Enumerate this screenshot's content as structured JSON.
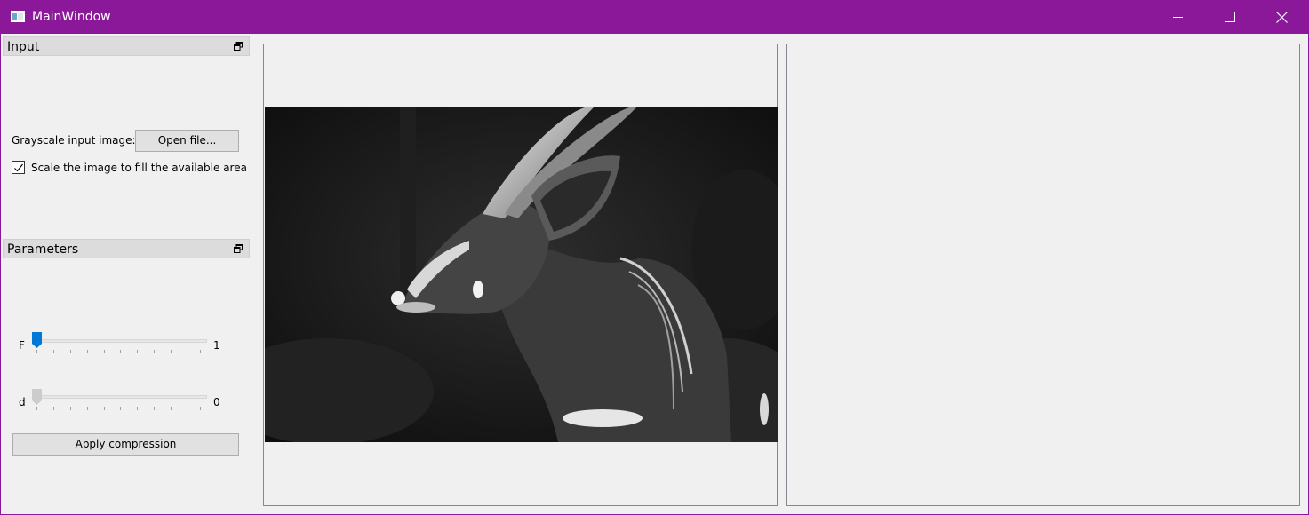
{
  "window": {
    "title": "MainWindow",
    "titlebar_color": "#8a1899",
    "icons": {
      "minimize": "minimize-icon",
      "maximize": "maximize-icon",
      "close": "close-icon"
    }
  },
  "input_dock": {
    "title": "Input",
    "image_label": "Grayscale input image:",
    "open_button": "Open file...",
    "scale_checkbox": {
      "label": "Scale the image to fill the available area",
      "checked": true
    }
  },
  "parameters_dock": {
    "title": "Parameters",
    "sliders": [
      {
        "label": "F",
        "value": "1",
        "enabled": true
      },
      {
        "label": "d",
        "value": "0",
        "enabled": false
      }
    ],
    "apply_button": "Apply compression"
  },
  "views": {
    "input_image": "grayscale photograph of an antelope (bushbuck) head in profile on dark background",
    "output_image": ""
  }
}
